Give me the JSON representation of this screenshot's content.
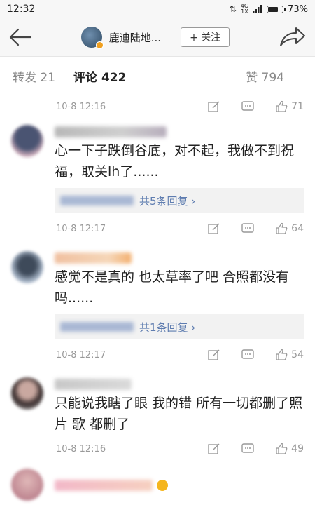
{
  "status": {
    "time": "12:32",
    "net_top": "4G",
    "net_bottom": "1X",
    "battery": "73%",
    "battery_level": 0.73
  },
  "header": {
    "name": "鹿迪陆地...",
    "follow": "+ 关注"
  },
  "tabs": {
    "repost": "转发 21",
    "comments": "评论 422",
    "likes": "赞 794"
  },
  "top_meta": {
    "time": "10-8 12:16",
    "like_count": "71"
  },
  "comments": [
    {
      "text": "心一下子跌倒谷底，对不起，我做不到祝福，取关lh了......",
      "reply": "共5条回复 ›",
      "time": "10-8 12:17",
      "like_count": "64"
    },
    {
      "text": "感觉不是真的 也太草率了吧 合照都没有吗......",
      "reply": "共1条回复 ›",
      "time": "10-8 12:17",
      "like_count": "54"
    },
    {
      "text": "只能说我瞎了眼  我的错  所有一切都删了照片  歌  都删了",
      "reply": "",
      "time": "10-8 12:16",
      "like_count": "49"
    }
  ],
  "colors": {
    "link": "#5f7db0",
    "text": "#222222",
    "meta": "#999999",
    "accent": "#f0a020"
  }
}
